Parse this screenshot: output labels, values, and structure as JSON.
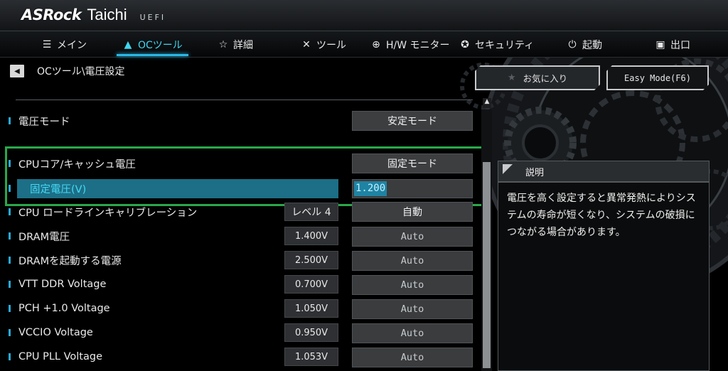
{
  "brand": {
    "logo": "ASRock",
    "product": "Taichi",
    "uefi": "UEFI"
  },
  "nav": [
    {
      "icon": "list-icon",
      "glyph": "☰",
      "label": "メイン",
      "active": false
    },
    {
      "icon": "rocket-icon",
      "glyph": "▲",
      "label": "OCツール",
      "active": true
    },
    {
      "icon": "star-icon",
      "glyph": "☆",
      "label": "詳細",
      "active": false
    },
    {
      "icon": "tools-icon",
      "glyph": "✕",
      "label": "ツール",
      "active": false
    },
    {
      "icon": "monitor-icon",
      "glyph": "⊕",
      "label": "H/W モニター",
      "active": false
    },
    {
      "icon": "shield-icon",
      "glyph": "✪",
      "label": "セキュリティ",
      "active": false
    },
    {
      "icon": "power-icon",
      "glyph": "⏻",
      "label": "起動",
      "active": false
    },
    {
      "icon": "exit-icon",
      "glyph": "▣",
      "label": "出口",
      "active": false
    }
  ],
  "breadcrumb": "OCツール\\電圧設定",
  "settings": {
    "voltage_mode": {
      "label": "電圧モード",
      "value": "安定モード"
    },
    "cpu_core_cache": {
      "label": "CPUコア/キャッシュ電圧",
      "value": "固定モード"
    },
    "fixed_voltage": {
      "label": "固定電圧(V)",
      "input": "1.200"
    },
    "llc": {
      "label": "CPU ロードラインキャリブレーション",
      "current": "レベル 4",
      "value": "自動"
    },
    "rows": [
      {
        "label": "DRAM電圧",
        "current": "1.400V",
        "value": "Auto"
      },
      {
        "label": "DRAMを起動する電源",
        "current": "2.500V",
        "value": "Auto"
      },
      {
        "label": "VTT DDR Voltage",
        "current": "0.700V",
        "value": "Auto"
      },
      {
        "label": "PCH +1.0 Voltage",
        "current": "1.050V",
        "value": "Auto"
      },
      {
        "label": "VCCIO Voltage",
        "current": "0.950V",
        "value": "Auto"
      },
      {
        "label": "CPU PLL Voltage",
        "current": "1.053V",
        "value": "Auto"
      }
    ]
  },
  "right_panel": {
    "favorites": "お気に入り",
    "easy_mode": "Easy Mode(F6)",
    "desc_title": "説明",
    "desc_text": "電圧を高く設定すると異常発熱によりシステムの寿命が短くなり、システムの破損につながる場合があります。"
  },
  "colors": {
    "accent": "#2ab9e6",
    "highlight": "#1c6f86",
    "annotation_box": "#29a84a"
  }
}
